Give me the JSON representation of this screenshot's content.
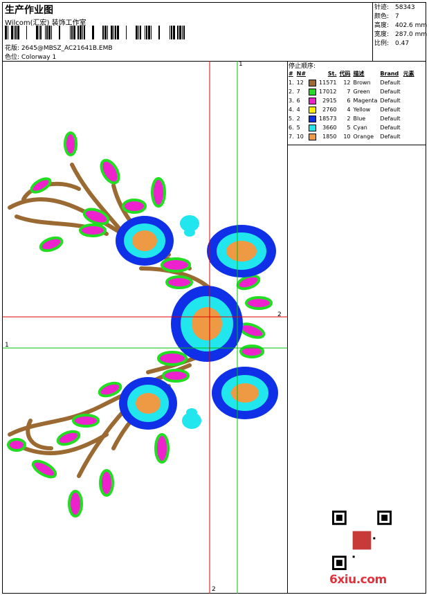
{
  "header": {
    "title": "生产作业图",
    "company": "Wilcom(汇宏) 装饰工作室",
    "design_label": "花版:",
    "design_value": "2645@MBSZ_AC21641B.EMB",
    "colorway_label": "色位:",
    "colorway_value": "Colorway 1"
  },
  "stats": [
    {
      "label": "针迹:",
      "value": "58343"
    },
    {
      "label": "颜色:",
      "value": "7"
    },
    {
      "label": "高度:",
      "value": "402.6 mm"
    },
    {
      "label": "宽度:",
      "value": "287.0 mm"
    },
    {
      "label": "比例:",
      "value": "0.47"
    }
  ],
  "stop_sequence": {
    "title": "停止顺序:",
    "headers": [
      "#",
      "N#",
      "St.",
      "代码",
      "描述",
      "Brand",
      "元素"
    ],
    "rows": [
      {
        "idx": "1.",
        "n": "12",
        "color": "#9a6a32",
        "st": "11571",
        "code": "12",
        "desc": "Brown",
        "brand": "Default"
      },
      {
        "idx": "2.",
        "n": "7",
        "color": "#22dd22",
        "st": "17012",
        "code": "7",
        "desc": "Green",
        "brand": "Default"
      },
      {
        "idx": "3.",
        "n": "6",
        "color": "#ee22cc",
        "st": "2915",
        "code": "6",
        "desc": "Magenta",
        "brand": "Default"
      },
      {
        "idx": "4.",
        "n": "4",
        "color": "#ffee00",
        "st": "2760",
        "code": "4",
        "desc": "Yellow",
        "brand": "Default"
      },
      {
        "idx": "5.",
        "n": "2",
        "color": "#1030e8",
        "st": "18573",
        "code": "2",
        "desc": "Blue",
        "brand": "Default"
      },
      {
        "idx": "6.",
        "n": "5",
        "color": "#22e6ee",
        "st": "3660",
        "code": "5",
        "desc": "Cyan",
        "brand": "Default"
      },
      {
        "idx": "7.",
        "n": "10",
        "color": "#ee9944",
        "st": "1850",
        "code": "10",
        "desc": "Orange",
        "brand": "Default"
      }
    ]
  },
  "guides": {
    "v_green": "1",
    "h_red": "2",
    "h_green": "1",
    "v_red": "2"
  },
  "watermark": "6xiu.com",
  "colors": {
    "guide_red": "#e00000",
    "guide_green": "#00c000"
  }
}
